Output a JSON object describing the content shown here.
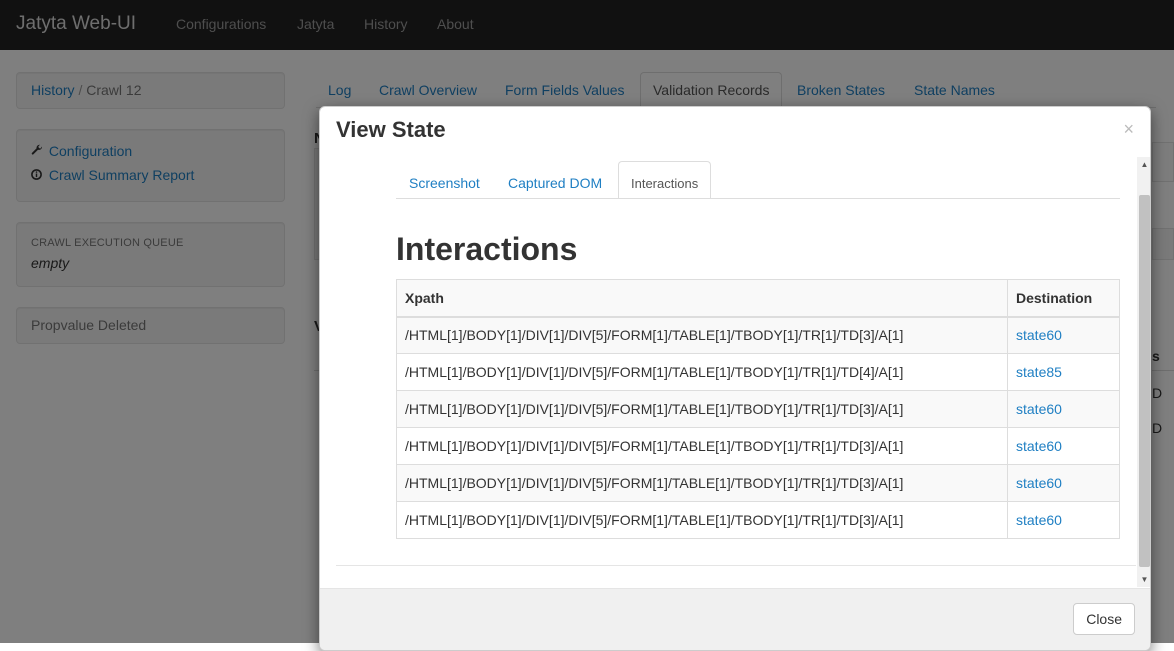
{
  "navbar": {
    "brand": "Jatyta Web-UI",
    "items": [
      "Configurations",
      "Jatyta",
      "History",
      "About"
    ]
  },
  "sidebar": {
    "breadcrumb": {
      "link": "History",
      "sep": "/",
      "current": "Crawl 12"
    },
    "links": [
      {
        "icon": "wrench-icon",
        "label": "Configuration"
      },
      {
        "icon": "info-circle-icon",
        "label": "Crawl Summary Report"
      }
    ],
    "queue": {
      "title": "CRAWL EXECUTION QUEUE",
      "value": "empty"
    },
    "status": "Propvalue Deleted"
  },
  "main": {
    "tabs": [
      "Log",
      "Crawl Overview",
      "Form Fields Values",
      "Validation Records",
      "Broken States",
      "State Names"
    ],
    "active_tab": "Validation Records",
    "partial_text": {
      "n": "N",
      "v": "V",
      "s": "s",
      "d1": "D",
      "d2": "D"
    }
  },
  "modal": {
    "title": "View State",
    "close_x": "×",
    "tabs": [
      "Screenshot",
      "Captured DOM",
      "Interactions"
    ],
    "active_tab": "Interactions",
    "section_title": "Interactions",
    "table": {
      "headers": [
        "Xpath",
        "Destination"
      ],
      "rows": [
        {
          "xpath": "/HTML[1]/BODY[1]/DIV[1]/DIV[5]/FORM[1]/TABLE[1]/TBODY[1]/TR[1]/TD[3]/A[1]",
          "destination": "state60"
        },
        {
          "xpath": "/HTML[1]/BODY[1]/DIV[1]/DIV[5]/FORM[1]/TABLE[1]/TBODY[1]/TR[1]/TD[4]/A[1]",
          "destination": "state85"
        },
        {
          "xpath": "/HTML[1]/BODY[1]/DIV[1]/DIV[5]/FORM[1]/TABLE[1]/TBODY[1]/TR[1]/TD[3]/A[1]",
          "destination": "state60"
        },
        {
          "xpath": "/HTML[1]/BODY[1]/DIV[1]/DIV[5]/FORM[1]/TABLE[1]/TBODY[1]/TR[1]/TD[3]/A[1]",
          "destination": "state60"
        },
        {
          "xpath": "/HTML[1]/BODY[1]/DIV[1]/DIV[5]/FORM[1]/TABLE[1]/TBODY[1]/TR[1]/TD[3]/A[1]",
          "destination": "state60"
        },
        {
          "xpath": "/HTML[1]/BODY[1]/DIV[1]/DIV[5]/FORM[1]/TABLE[1]/TBODY[1]/TR[1]/TD[3]/A[1]",
          "destination": "state60"
        }
      ]
    },
    "close_button": "Close"
  },
  "colors": {
    "navbar": "#222222",
    "link": "#1f7fc3",
    "backdrop": "rgba(0,0,0,0.5)"
  }
}
